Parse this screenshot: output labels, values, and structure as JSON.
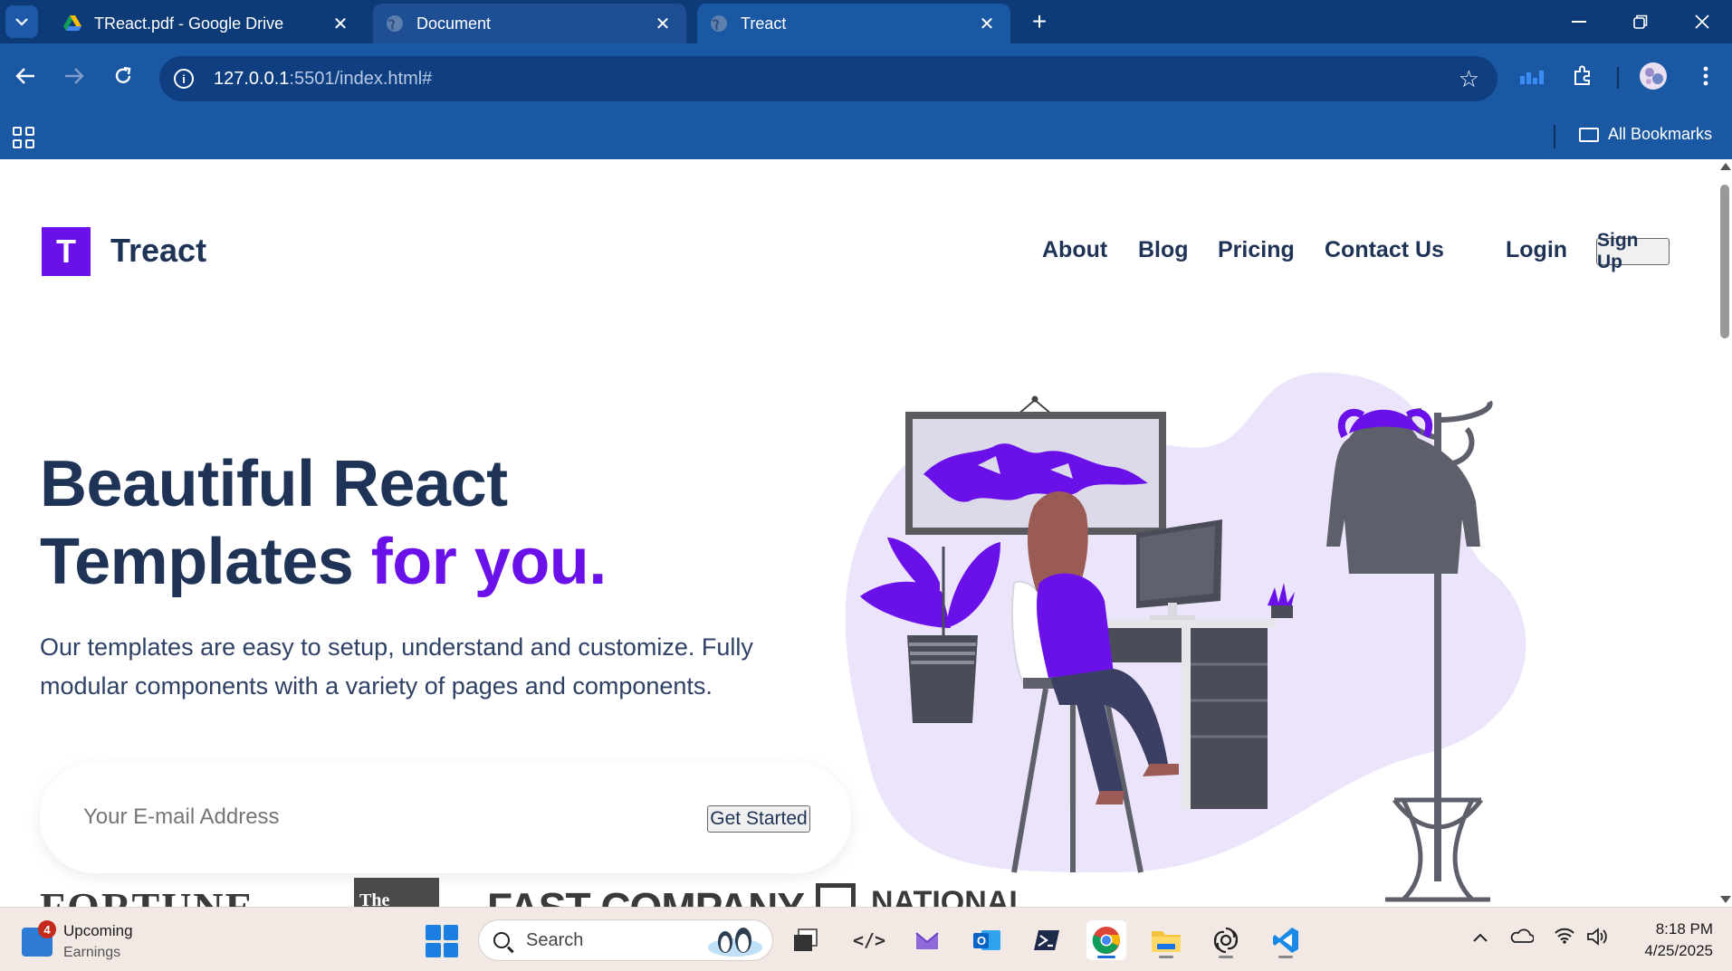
{
  "browser": {
    "tabs": [
      {
        "title": "TReact.pdf - Google Drive",
        "icon": "google-drive-icon",
        "state": "inactive"
      },
      {
        "title": "Document",
        "icon": "globe-icon",
        "state": "inactive"
      },
      {
        "title": "Treact",
        "icon": "globe-icon",
        "state": "active"
      }
    ],
    "url_host": "127.0.0.1",
    "url_path": ":5501/index.html#",
    "bookmarks_label": "All Bookmarks"
  },
  "page": {
    "logo_letter": "T",
    "logo_text": "Treact",
    "nav": [
      "About",
      "Blog",
      "Pricing",
      "Contact Us"
    ],
    "login_label": "Login",
    "signup_label": "Sign Up",
    "hero_title_line1": "Beautiful React",
    "hero_title_line2": "Templates ",
    "hero_title_accent": "for you.",
    "hero_subtitle": "Our templates are easy to setup, understand and customize. Fully modular components with a variety of pages and components.",
    "email_placeholder": "Your E-mail Address",
    "cta_label": "Get Started",
    "press_logos": [
      "FORTUNE",
      "The",
      "FAST COMPANY",
      "NATIONAL"
    ],
    "accent_color": "#6a11ea",
    "heading_color": "#1e3356"
  },
  "taskbar": {
    "widget_badge": "4",
    "widget_title": "Upcoming",
    "widget_sub": "Earnings",
    "search_label": "Search",
    "time": "8:18 PM",
    "date": "4/25/2025"
  }
}
